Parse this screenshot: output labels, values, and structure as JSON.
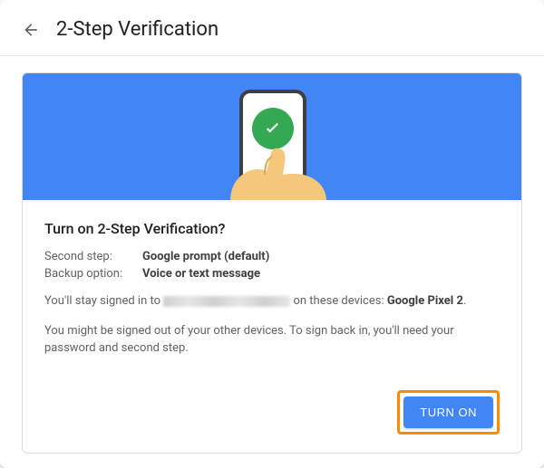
{
  "header": {
    "title": "2-Step Verification"
  },
  "card": {
    "heading": "Turn on 2-Step Verification?",
    "rows": {
      "second_step_label": "Second step:",
      "second_step_value": "Google prompt (default)",
      "backup_label": "Backup option:",
      "backup_value": "Voice or text message"
    },
    "signed_in_prefix": "You'll stay signed in to ",
    "signed_in_suffix_1": " on these devices: ",
    "signed_in_device": "Google Pixel 2",
    "signed_in_end": ".",
    "warning": "You might be signed out of your other devices. To sign back in, you'll need your password and second step.",
    "turn_on_label": "TURN ON"
  }
}
